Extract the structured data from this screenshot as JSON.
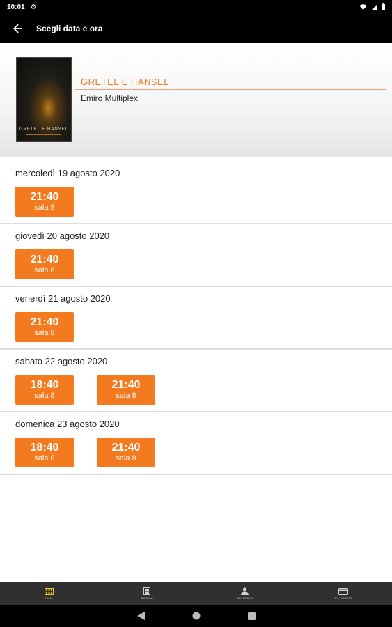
{
  "status": {
    "time": "10:01"
  },
  "app_bar": {
    "title": "Scegli data e ora"
  },
  "film": {
    "poster_title": "GRETEL E HANSEL",
    "title": "GRETEL E HANSEL",
    "cinema": "Emiro Multiplex"
  },
  "days": [
    {
      "label": "mercoledì 19 agosto 2020",
      "times": [
        {
          "time": "21:40",
          "room": "sala 8"
        }
      ]
    },
    {
      "label": "giovedì 20 agosto 2020",
      "times": [
        {
          "time": "21:40",
          "room": "sala 8"
        }
      ]
    },
    {
      "label": "venerdì 21 agosto 2020",
      "times": [
        {
          "time": "21:40",
          "room": "sala 8"
        }
      ]
    },
    {
      "label": "sabato 22 agosto 2020",
      "times": [
        {
          "time": "18:40",
          "room": "sala 8"
        },
        {
          "time": "21:40",
          "room": "sala 8"
        }
      ]
    },
    {
      "label": "domenica 23 agosto 2020",
      "times": [
        {
          "time": "18:40",
          "room": "sala 8"
        },
        {
          "time": "21:40",
          "room": "sala 8"
        }
      ]
    }
  ],
  "bottom_nav": [
    {
      "label": "FILM",
      "icon": "film-icon",
      "active": true
    },
    {
      "label": "CINEMA",
      "icon": "cinema-icon",
      "active": false
    },
    {
      "label": "MY MEDIC",
      "icon": "person-icon",
      "active": false
    },
    {
      "label": "MY TICKETS",
      "icon": "ticket-icon",
      "active": false
    }
  ],
  "colors": {
    "accent": "#f47a20",
    "nav_active": "#e8c020",
    "bar": "#000000"
  }
}
